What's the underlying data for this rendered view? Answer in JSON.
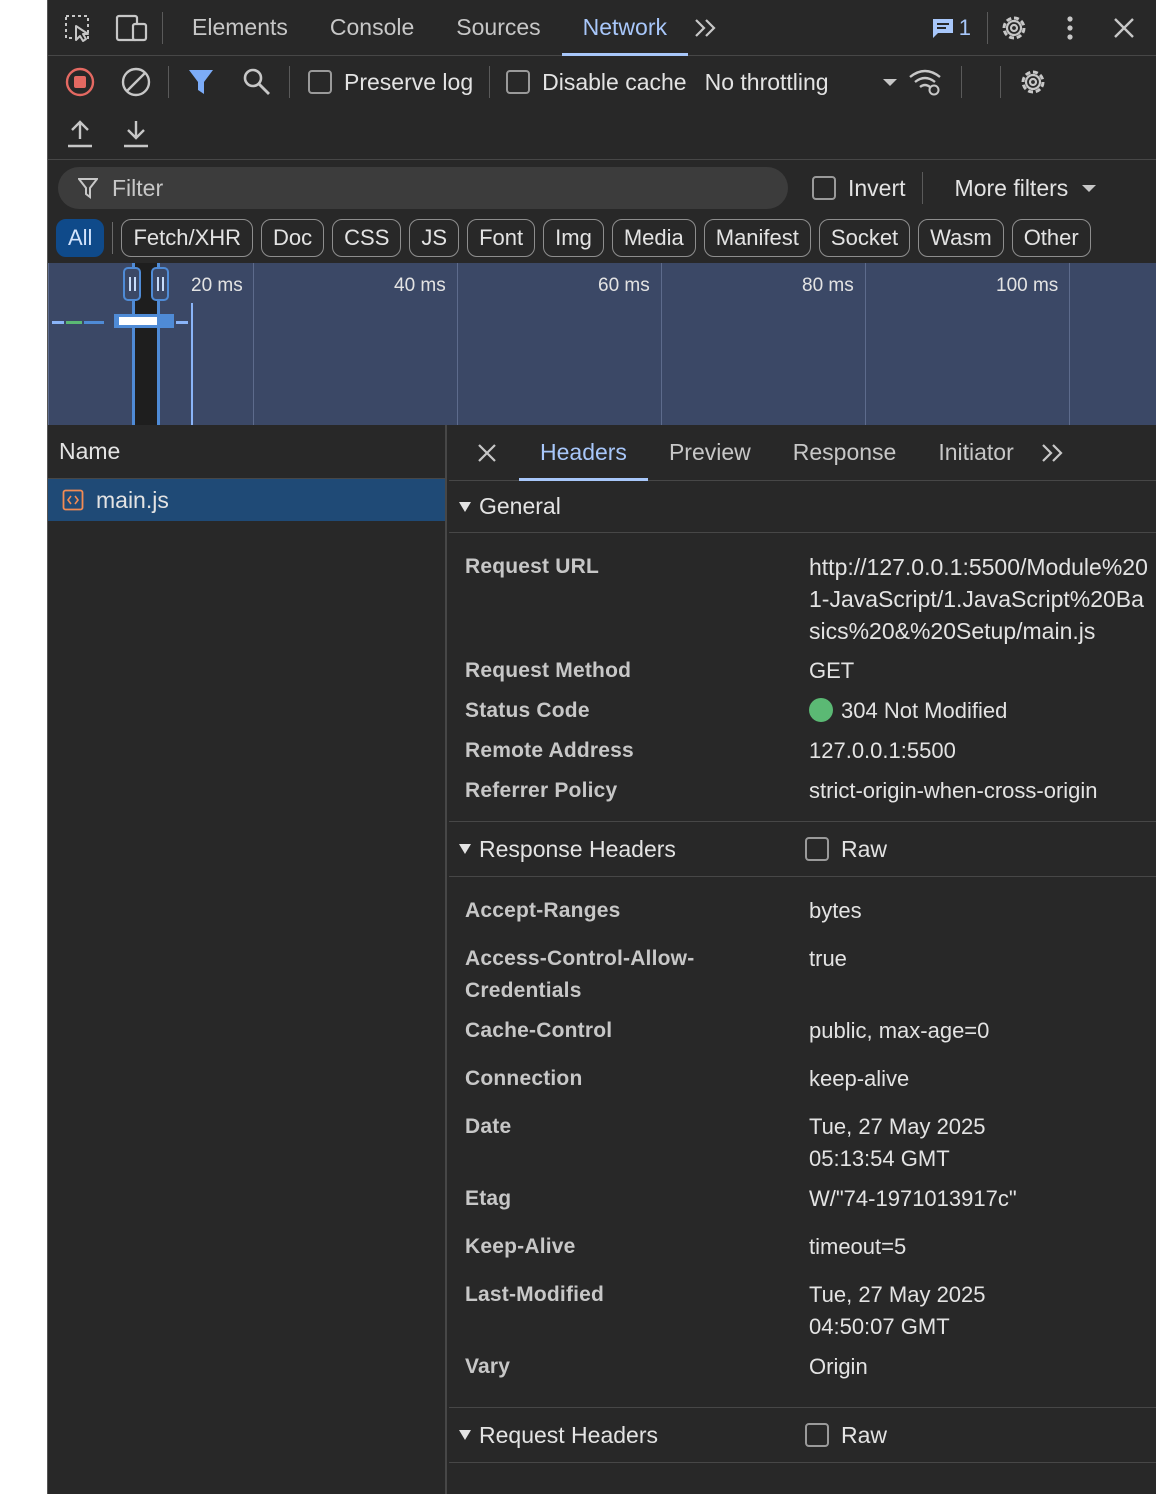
{
  "tabs": [
    {
      "label": "Elements"
    },
    {
      "label": "Console"
    },
    {
      "label": "Sources"
    },
    {
      "label": "Network"
    }
  ],
  "issues_count": "1",
  "toolbar": {
    "preserve_log": "Preserve log",
    "disable_cache": "Disable cache",
    "throttling": "No throttling"
  },
  "filter": {
    "placeholder": "Filter",
    "invert": "Invert",
    "more_filters": "More filters"
  },
  "types": [
    "All",
    "Fetch/XHR",
    "Doc",
    "CSS",
    "JS",
    "Font",
    "Img",
    "Media",
    "Manifest",
    "Socket",
    "Wasm",
    "Other"
  ],
  "overview": {
    "ticks": [
      "20 ms",
      "40 ms",
      "60 ms",
      "80 ms",
      "100 ms"
    ]
  },
  "requests": {
    "column_name": "Name",
    "items": [
      {
        "name": "main.js"
      }
    ]
  },
  "detail": {
    "tabs": [
      "Headers",
      "Preview",
      "Response",
      "Initiator"
    ],
    "general": {
      "title": "General",
      "rows": [
        {
          "key": "Request URL",
          "value": "http://127.0.0.1:5500/Module%201-JavaScript/1.JavaScript%20Basics%20&%20Setup/main.js"
        },
        {
          "key": "Request Method",
          "value": "GET"
        },
        {
          "key": "Status Code",
          "value": "304 Not Modified"
        },
        {
          "key": "Remote Address",
          "value": "127.0.0.1:5500"
        },
        {
          "key": "Referrer Policy",
          "value": "strict-origin-when-cross-origin"
        }
      ]
    },
    "response_headers": {
      "title": "Response Headers",
      "raw_label": "Raw",
      "rows": [
        {
          "key": "Accept-Ranges",
          "value": "bytes"
        },
        {
          "key": "Access-Control-Allow-Credentials",
          "value": "true"
        },
        {
          "key": "Cache-Control",
          "value": "public, max-age=0"
        },
        {
          "key": "Connection",
          "value": "keep-alive"
        },
        {
          "key": "Date",
          "value": "Tue, 27 May 2025 05:13:54 GMT"
        },
        {
          "key": "Etag",
          "value": "W/\"74-1971013917c\""
        },
        {
          "key": "Keep-Alive",
          "value": "timeout=5"
        },
        {
          "key": "Last-Modified",
          "value": "Tue, 27 May 2025 04:50:07 GMT"
        },
        {
          "key": "Vary",
          "value": "Origin"
        }
      ]
    },
    "request_headers": {
      "title": "Request Headers",
      "raw_label": "Raw"
    }
  },
  "colors": {
    "accent": "#a8c7fa",
    "status_ok": "#5bb974",
    "record": "#e46962",
    "filter_active": "#7cacf8"
  }
}
